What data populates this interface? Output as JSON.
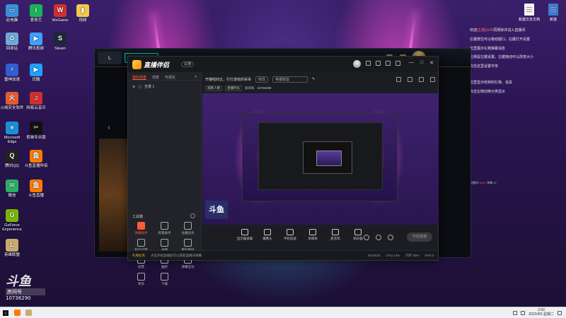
{
  "desktop": {
    "icons_left": [
      {
        "label": "此电脑",
        "color": "#3a8fd8",
        "glyph": "▭"
      },
      {
        "label": "爱奇艺",
        "color": "#18b35a",
        "glyph": "i"
      },
      {
        "label": "WeGame",
        "color": "#d32f2f",
        "glyph": "W"
      },
      {
        "label": "视频",
        "color": "#f2c94c",
        "glyph": "▮"
      },
      {
        "label": "回收站",
        "color": "#6fa8dc",
        "glyph": "♻"
      },
      {
        "label": "腾讯视频",
        "color": "#3ea0ff",
        "glyph": "▶"
      },
      {
        "label": "Steam",
        "color": "#1b2838",
        "glyph": "S"
      },
      {
        "label": "雷神加速",
        "color": "#2f5fd0",
        "glyph": "⚡"
      },
      {
        "label": "优酷",
        "color": "#1ea0ff",
        "glyph": "▶"
      },
      {
        "label": "火绒安全软件",
        "color": "#e85c2c",
        "glyph": "火"
      },
      {
        "label": "网易云音乐",
        "color": "#d02f2f",
        "glyph": "♫"
      },
      {
        "label": "Microsoft Edge",
        "color": "#1a8fd8",
        "glyph": "e"
      },
      {
        "label": "剪映专业版",
        "color": "#111111",
        "glyph": "✂"
      },
      {
        "label": "腾讯QQ",
        "color": "#222222",
        "glyph": "Q"
      },
      {
        "label": "斗鱼直播伴侣",
        "color": "#ff7a00",
        "glyph": "鱼"
      },
      {
        "label": "微信",
        "color": "#2aae67",
        "glyph": "✉"
      },
      {
        "label": "斗鱼直播",
        "color": "#ff7a00",
        "glyph": "鱼"
      },
      {
        "label": "GeForce Experience",
        "color": "#76b900",
        "glyph": "G"
      },
      {
        "label": "英雄联盟",
        "color": "#c8aa6e",
        "glyph": "L"
      }
    ],
    "files_right": [
      {
        "label": "新建文本文档"
      },
      {
        "label": "新建"
      }
    ]
  },
  "chat_overlay": {
    "lines": [
      {
        "pre": "欢迎",
        "hl": "[主播]1145",
        "post": "同网际并进入直播间"
      },
      {
        "pre": "左键按住可以拖动窗口，右键打开设置",
        "hl": "",
        "post": ""
      },
      {
        "pre": "这里展示礼物弹幕消息",
        "hl": "",
        "post": ""
      },
      {
        "pre": "左侧是左键设置，左键拖动可以改变大小",
        "hl": "",
        "post": ""
      },
      {
        "pre": "点击这里设置字体",
        "hl": "",
        "post": ""
      },
      {
        "pre": "这里显示收到的礼物、道具",
        "hl": "",
        "post": ""
      },
      {
        "pre": "点击左侧切换分类显示",
        "hl": "",
        "post": ""
      }
    ],
    "stats": {
      "pre": "直播间 ",
      "hl": "302:1 ",
      "post": "弹幕 37"
    }
  },
  "app": {
    "logo_text": "直播伴侣",
    "version": "公测",
    "window_controls": [
      "—",
      "□",
      "✕"
    ],
    "left_tabs": [
      {
        "label": "我的场景",
        "active": true
      },
      {
        "label": "场景",
        "active": false
      },
      {
        "label": "可视化",
        "active": false
      }
    ],
    "left_tab_plus": "+",
    "scene_name": "全景 1",
    "tools_label": "工具箱",
    "tools": [
      {
        "label": "弹幕助手",
        "hot": true
      },
      {
        "label": "房管助手",
        "hot": false
      },
      {
        "label": "主播任务",
        "hot": false
      },
      {
        "label": "粉丝运营",
        "hot": false
      },
      {
        "label": "录播",
        "hot": false
      },
      {
        "label": "精彩瞬间",
        "hot": false
      },
      {
        "label": "投票",
        "hot": false
      },
      {
        "label": "抽奖",
        "hot": false
      },
      {
        "label": "弹幕互动",
        "hot": false
      },
      {
        "label": "更多",
        "hot": false
      },
      {
        "label": "下载",
        "hot": false
      }
    ],
    "header": {
      "title": "开播啦四五，打打游戏的哥哥",
      "tag": "修改",
      "category": "英雄联盟"
    },
    "subheader": {
      "chip1": "观看人数",
      "chip2": "直播时长",
      "room_label": "房间号",
      "room_id": "10736290"
    },
    "preview_badge": "斗鱼",
    "bottom_bar": [
      {
        "label": "显示器采集"
      },
      {
        "label": "摄像头"
      },
      {
        "label": "手机投屏"
      },
      {
        "label": "多媒体"
      },
      {
        "label": "麦克风"
      },
      {
        "label": "扬声器"
      }
    ],
    "live_button": "开始直播",
    "status": {
      "gift_tip": "礼物任务",
      "tip": "点击开始直播后可以获取直播间弹幕",
      "stats": [
        "00:00:00",
        "CPU 14%",
        "内存 30%",
        "FPS 0"
      ]
    }
  },
  "watermark": {
    "logo": "斗鱼",
    "room_label": "房间号",
    "room_id": "10736290"
  },
  "taskbar": {
    "time": "2:50",
    "date": "2022/4/5 星期二",
    "apps": [
      {
        "name": "douyu-app",
        "color": "#ff7a00"
      },
      {
        "name": "league-app",
        "color": "#c8aa6e"
      }
    ]
  }
}
